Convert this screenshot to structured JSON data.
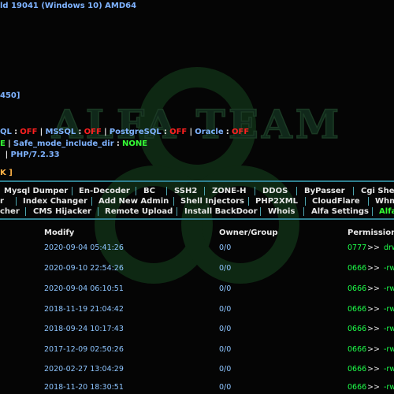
{
  "system": {
    "uname_tail": "ld 19041 (Windows 10) AMD64",
    "port_fragment": "450]"
  },
  "databases": {
    "items": [
      {
        "name": "QL",
        "status": "OFF"
      },
      {
        "name": "MSSQL",
        "status": "OFF"
      },
      {
        "name": "PostgreSQL",
        "status": "OFF"
      },
      {
        "name": "Oracle",
        "status": "OFF"
      }
    ],
    "sep": "|",
    "colon": ":"
  },
  "safe_mode": {
    "lead": "E",
    "label": "Safe_mode_include_dir",
    "value": "NONE",
    "colon": ":",
    "sep": "|"
  },
  "php": {
    "lead": " ",
    "sep": "|",
    "version": "PHP/7.2.33"
  },
  "shortcut": {
    "label": "K ]"
  },
  "watermark": {
    "text": "ALFA TEAM"
  },
  "menu": {
    "row1": [
      "Mysql Dumper",
      "En-Decoder",
      "BC",
      "SSH2",
      "ZONE-H",
      "DDOS",
      "ByPasser",
      "Cgi Shell"
    ],
    "row2": [
      "r",
      "Index Changer",
      "Add New Admin",
      "Shell Injectors",
      "PHP2XML",
      "CloudFlare",
      "Whm"
    ],
    "row3": [
      "cher",
      "CMS Hijacker",
      "Remote Upload",
      "Install BackDoor",
      "Whois",
      "Alfa Settings",
      "Alfa"
    ]
  },
  "table": {
    "headers": {
      "modify": "Modify",
      "owner": "Owner/Group",
      "permissions": "Permissions"
    },
    "arrow": ">>",
    "rows": [
      {
        "modify": "2020-09-04 05:41:26",
        "owner": "0/0",
        "perm": "0777",
        "perm_str": "drw"
      },
      {
        "modify": "2020-09-10 22:54:26",
        "owner": "0/0",
        "perm": "0666",
        "perm_str": "-rw"
      },
      {
        "modify": "2020-09-04 06:10:51",
        "owner": "0/0",
        "perm": "0666",
        "perm_str": "-rw"
      },
      {
        "modify": "2018-11-19 21:04:42",
        "owner": "0/0",
        "perm": "0666",
        "perm_str": "-rw"
      },
      {
        "modify": "2018-09-24 10:17:43",
        "owner": "0/0",
        "perm": "0666",
        "perm_str": "-rw"
      },
      {
        "modify": "2017-12-09 02:50:26",
        "owner": "0/0",
        "perm": "0666",
        "perm_str": "-rw"
      },
      {
        "modify": "2020-02-27 13:04:29",
        "owner": "0/0",
        "perm": "0666",
        "perm_str": "-rw"
      },
      {
        "modify": "2018-11-20 18:30:51",
        "owner": "0/0",
        "perm": "0666",
        "perm_str": "-rw"
      }
    ]
  },
  "colors": {
    "background": "#050505",
    "info_blue": "#7fb3ff",
    "off_red": "#ff2020",
    "on_green": "#35ff35",
    "perm_green": "#1eff4a",
    "accent_teal": "#2f7f8f"
  }
}
